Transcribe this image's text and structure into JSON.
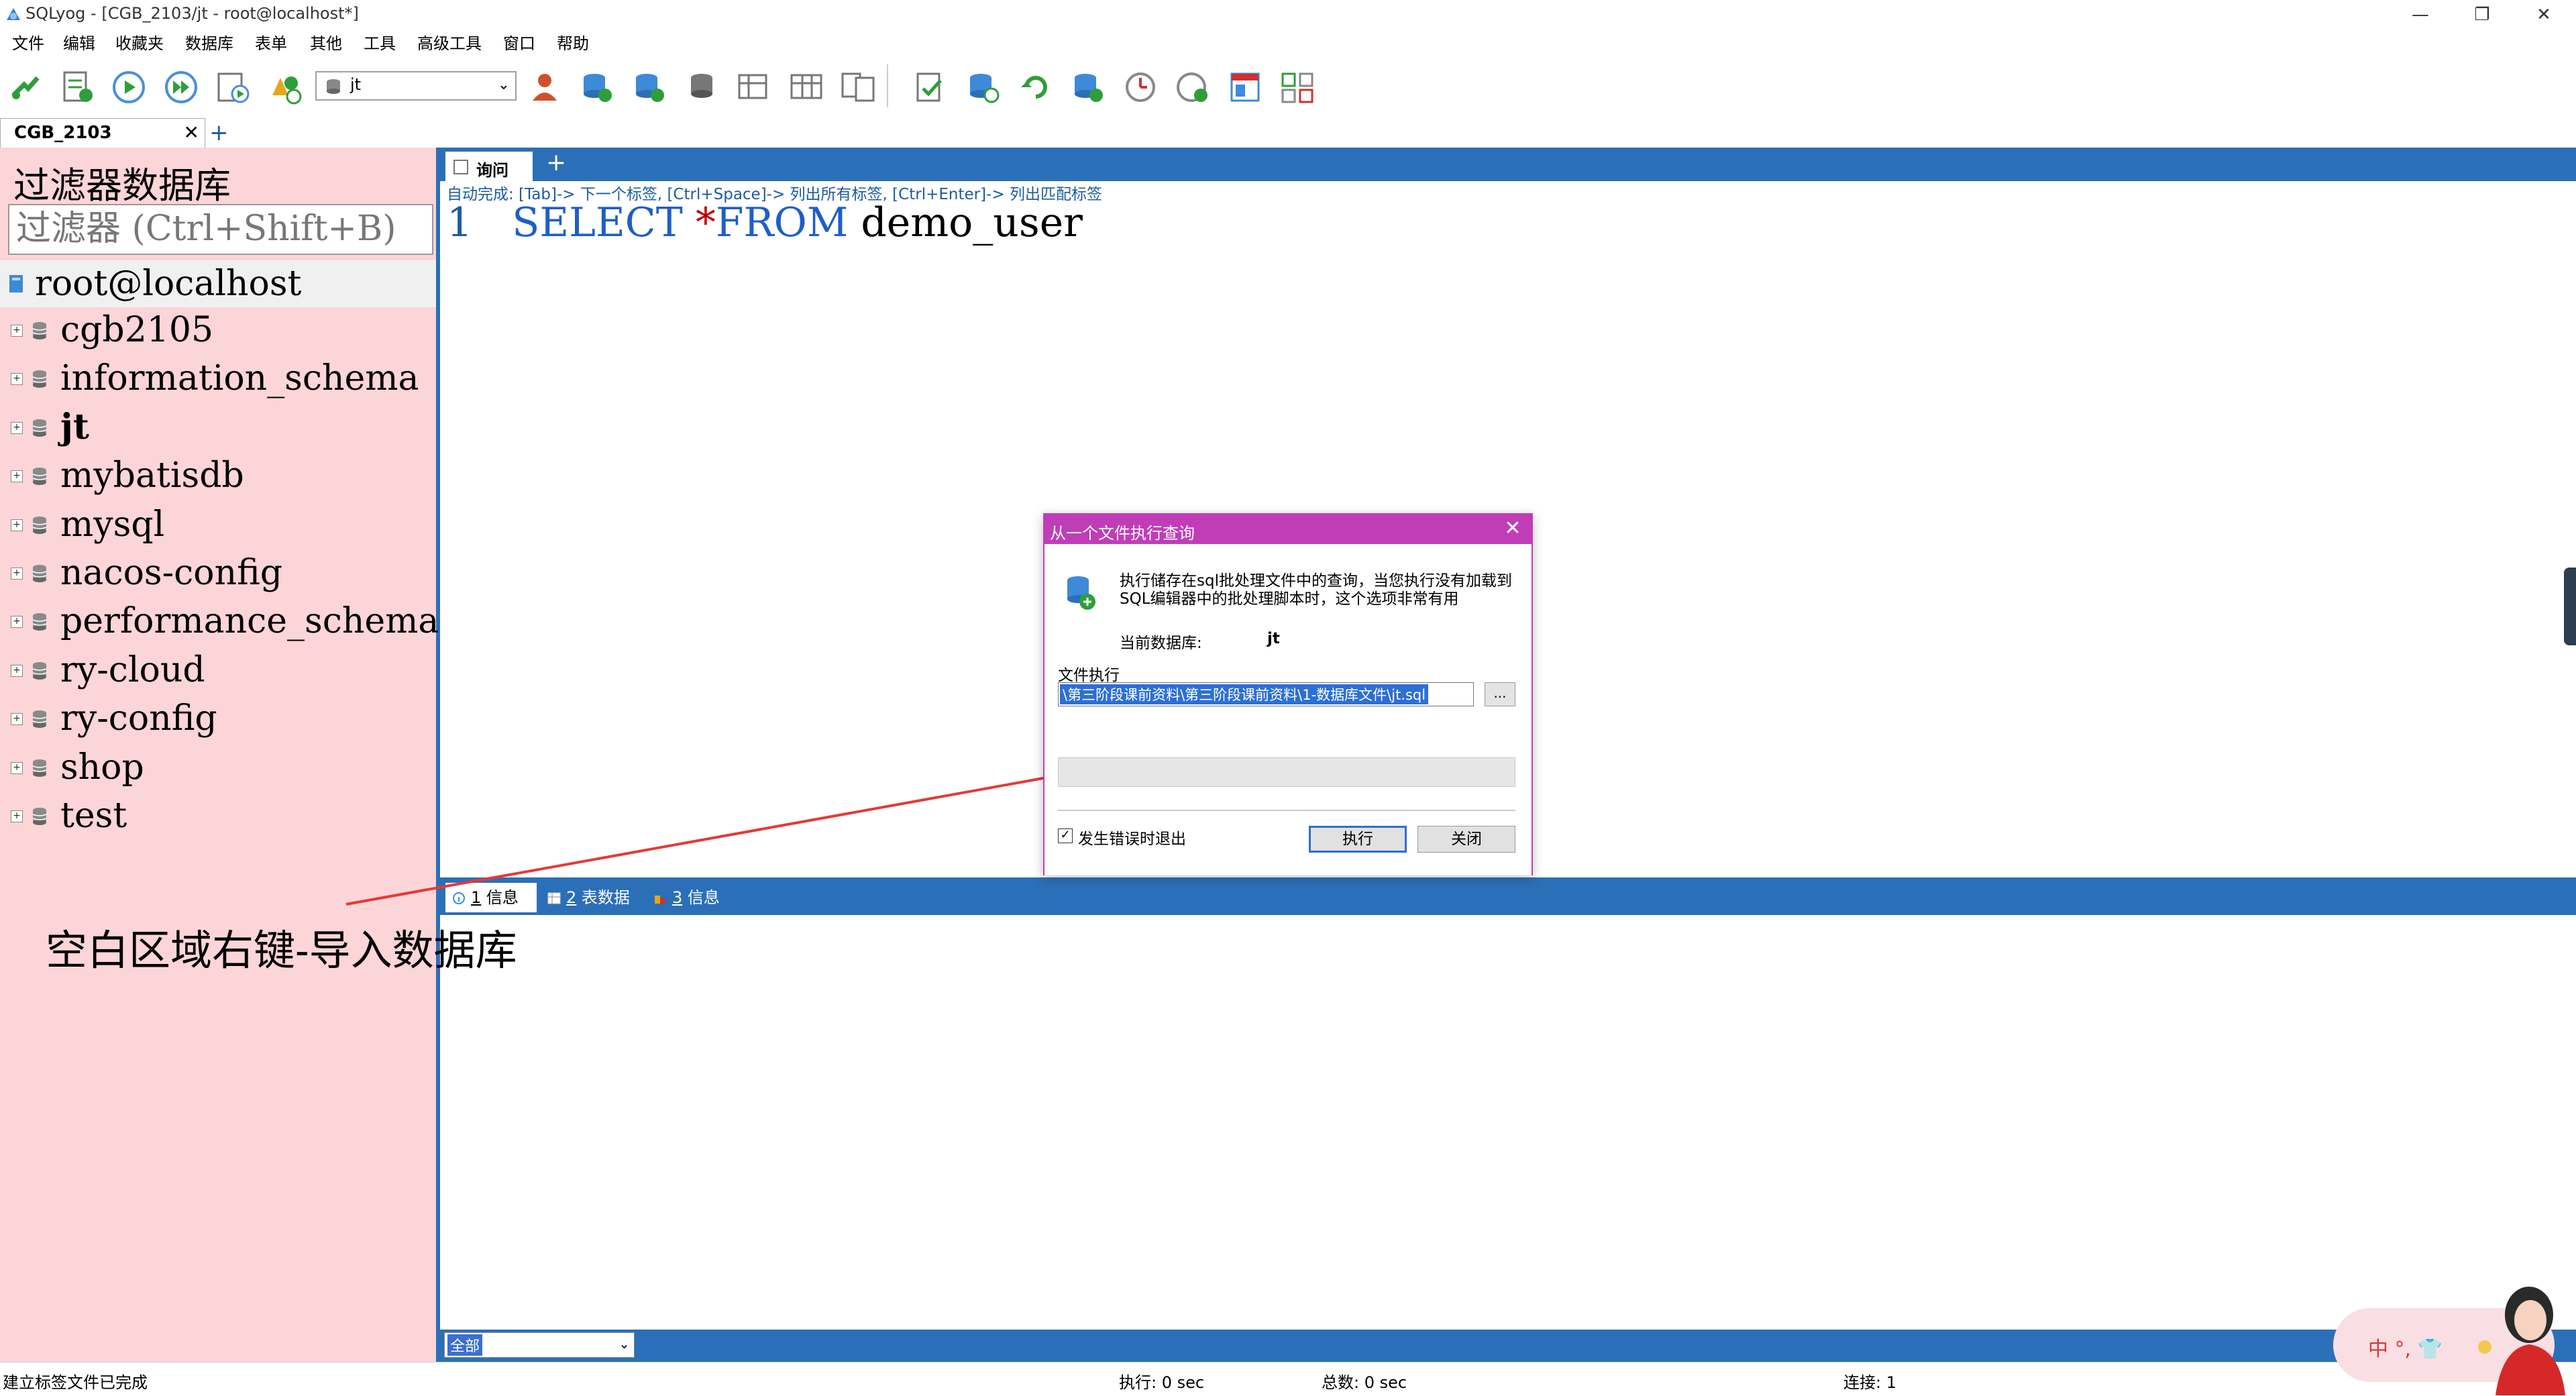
{
  "window": {
    "title": "SQLyog - [CGB_2103/jt - root@localhost*]",
    "minimize_glyph": "—",
    "restore_glyph": "❐",
    "close_glyph": "✕"
  },
  "menu": [
    "文件",
    "编辑",
    "收藏夹",
    "数据库",
    "表单",
    "其他",
    "工具",
    "高级工具",
    "窗口",
    "帮助"
  ],
  "toolbar": {
    "db_select_value": "jt",
    "icons": [
      "new-connection-icon",
      "new-query-icon",
      "execute-query-icon",
      "execute-all-icon",
      "execute-update-icon",
      "schema-designer-icon",
      "user-manager-icon",
      "import-icon",
      "create-db-icon",
      "backup-icon",
      "restore-icon",
      "table-data-icon",
      "query-builder-icon",
      "schema-sync-icon",
      "copy-db-icon",
      "data-sync-icon",
      "refresh-icon",
      "sql-import-icon",
      "scheduler-icon",
      "notification-icon",
      "export-icon",
      "data-search-icon"
    ]
  },
  "connection_tab": {
    "label": "CGB_2103",
    "close_glyph": "✕",
    "add_glyph": "+"
  },
  "object_browser": {
    "filter_title": "过滤器数据库",
    "filter_placeholder": "过滤器 (Ctrl+Shift+B)",
    "root_label": "root@localhost",
    "databases": [
      {
        "name": "cgb2105",
        "active": false
      },
      {
        "name": "information_schema",
        "active": false
      },
      {
        "name": "jt",
        "active": true
      },
      {
        "name": "mybatisdb",
        "active": false
      },
      {
        "name": "mysql",
        "active": false
      },
      {
        "name": "nacos-config",
        "active": false
      },
      {
        "name": "performance_schema",
        "active": false
      },
      {
        "name": "ry-cloud",
        "active": false
      },
      {
        "name": "ry-config",
        "active": false
      },
      {
        "name": "shop",
        "active": false
      },
      {
        "name": "test",
        "active": false
      }
    ],
    "expand_glyph": "+"
  },
  "query": {
    "tab_label": "询问",
    "add_glyph": "+",
    "hint": "自动完成: [Tab]-> 下一个标签, [Ctrl+Space]-> 列出所有标签, [Ctrl+Enter]-> 列出匹配标签",
    "line_number": "1",
    "kw_select": "SELECT",
    "op_star": "*",
    "kw_from": "FROM",
    "identifier": "demo_user"
  },
  "results": {
    "tabs": [
      {
        "num": "1",
        "label": "信息"
      },
      {
        "num": "2",
        "label": "表数据"
      },
      {
        "num": "3",
        "label": "信息"
      }
    ],
    "filter_value": "全部",
    "dropdown_glyph": "⌄"
  },
  "status": {
    "left": "建立标签文件已完成",
    "exec": "执行: 0 sec",
    "total": "总数: 0 sec",
    "conn": "连接: 1"
  },
  "dialog": {
    "title": "从一个文件执行查询",
    "close_glyph": "✕",
    "desc": "执行储存在sql批处理文件中的查询，当您执行没有加载到SQL编辑器中的批处理脚本时，这个选项非常有用",
    "current_db_label": "当前数据库:",
    "current_db_value": "jt",
    "file_label": "文件执行",
    "file_path": "\\第三阶段课前资料\\第三阶段课前资料\\1-数据库文件\\jt.sql",
    "browse_label": "...",
    "checkbox_glyph": "✓",
    "checkbox_label": "发生错误时退出",
    "checkbox_checked": true,
    "execute_label": "执行",
    "close_label": "关闭"
  },
  "annotation": {
    "text": "空白区域右键-导入数据库",
    "arrow_color": "#e53935"
  },
  "ime_widget": {
    "text": "中 °, 👕"
  },
  "colors": {
    "left_pane_bg": "#fcd5d8",
    "accent_blue": "#2b6fb8",
    "dialog_title": "#c13db8",
    "keyword_blue": "#1f5ec8",
    "operator_red": "#c00000"
  }
}
